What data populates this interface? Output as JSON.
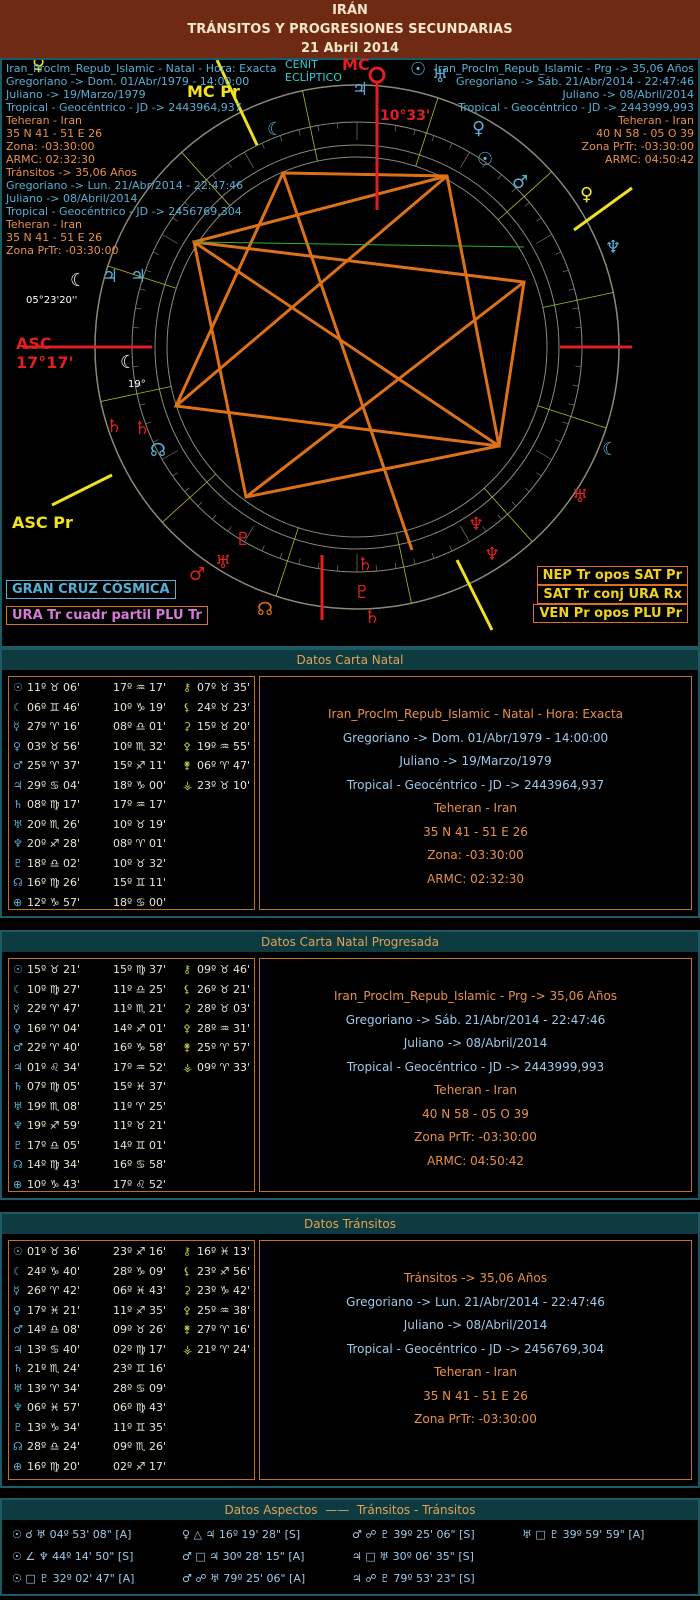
{
  "header": {
    "country": "IRÁN",
    "title": "TRÁNSITOS Y PROGRESIONES SECUNDARIAS",
    "date": "21 Abril 2014"
  },
  "chart_left": {
    "lines": [
      "Iran_Proclm_Repub_Islamic - Natal - Hora: Exacta",
      "Gregoriano -> Dom. 01/Abr/1979 - 14:00:00",
      "Juliano -> 19/Marzo/1979",
      "Tropical - Geocéntrico - JD -> 2443964,937",
      "Teheran - Iran",
      "35 N 41 - 51 E 26",
      "Zona: -03:30:00",
      "ARMC: 02:32:30",
      "Tránsitos -> 35,06 Años",
      "Gregoriano -> Lun. 21/Abr/2014 - 22:47:46",
      "Juliano -> 08/Abril/2014",
      "Tropical - Geocéntrico - JD -> 2456769,304",
      "Teheran - Iran",
      "35 N 41 - 51 E 26",
      "Zona PrTr: -03:30:00"
    ]
  },
  "chart_right": {
    "lines": [
      "Iran_Proclm_Repub_Islamic - Prg -> 35,06 Años",
      "Gregoriano -> Sáb. 21/Abr/2014 - 22:47:46",
      "Juliano -> 08/Abril/2014",
      "Tropical - Geocéntrico - JD -> 2443999,993",
      "Teheran - Iran",
      "40 N 58 - 05 O 39",
      "Zona PrTr: -03:30:00",
      "ARMC: 04:50:42"
    ]
  },
  "chart_labels": {
    "cenit": "CENIT",
    "ecliptico": "ECLÍPTICO",
    "mc": "MC",
    "mc_pr": "MC Pr",
    "mc_deg": "10°33'",
    "asc": "ASC",
    "asc_deg": "17°17'",
    "asc_pr": "ASC Pr",
    "moon_deg": "05°23'20''",
    "moon_small": "19°"
  },
  "badges": [
    {
      "text": "GRAN CRUZ CÓSMICA",
      "color": "#56b0d6"
    },
    {
      "text": "URA Tr cuadr partil PLU Tr",
      "color": "#d67ad6"
    },
    {
      "text": "NEP Tr opos SAT Pr",
      "color": "#f0d020"
    },
    {
      "text": "SAT Tr conj URA Rx",
      "color": "#f0d020"
    },
    {
      "text": "VEN Pr opos PLU Pr",
      "color": "#f0d020"
    }
  ],
  "natal": {
    "bar": "Datos Carta Natal",
    "col1": [
      {
        "g": "☉",
        "v": "11º ♉ 06'"
      },
      {
        "g": "☾",
        "v": "06º ♊ 46'"
      },
      {
        "g": "☿",
        "v": "27º ♈ 16'"
      },
      {
        "g": "♀",
        "v": "03º ♉ 56'"
      },
      {
        "g": "♂",
        "v": "25º ♈ 37'"
      },
      {
        "g": "♃",
        "v": "29º ♋ 04'"
      },
      {
        "g": "♄",
        "v": "08º ♍ 17'"
      },
      {
        "g": "♅",
        "v": "20º ♏ 26'"
      },
      {
        "g": "♆",
        "v": "20º ♐ 28'"
      },
      {
        "g": "♇",
        "v": "18º ♎ 02'"
      },
      {
        "g": "☊",
        "v": "16º ♍ 26'"
      },
      {
        "g": "⊕",
        "v": "12º ♑ 57'"
      }
    ],
    "col2": [
      "17º ♒ 17'",
      "10º ♑ 19'",
      "08º ♎ 01'",
      "10º ♏ 32'",
      "15º ♐ 11'",
      "18º ♑ 00'",
      "17º ♒ 17'",
      "10º ♉ 19'",
      "08º ♈ 01'",
      "10º ♉ 32'",
      "15º ♊ 11'",
      "18º ♋ 00'"
    ],
    "col3": [
      {
        "g": "⚷",
        "v": "07º ♉ 35'"
      },
      {
        "g": "⚸",
        "v": "24º ♉ 23'"
      },
      {
        "g": "⚳",
        "v": "15º ♉ 20'"
      },
      {
        "g": "⚴",
        "v": "19º ♒ 55'"
      },
      {
        "g": "⚵",
        "v": "06º ♈ 47'"
      },
      {
        "g": "⚶",
        "v": "23º ♉ 10'"
      }
    ],
    "info": [
      "Iran_Proclm_Repub_Islamic - Natal - Hora: Exacta",
      "Gregoriano -> Dom. 01/Abr/1979 - 14:00:00",
      "Juliano -> 19/Marzo/1979",
      "Tropical - Geocéntrico - JD -> 2443964,937",
      "Teheran - Iran",
      "35 N 41 - 51 E 26",
      "Zona: -03:30:00",
      "ARMC: 02:32:30"
    ]
  },
  "progresada": {
    "bar": "Datos Carta Natal Progresada",
    "col1": [
      {
        "g": "☉",
        "v": "15º ♉ 21'"
      },
      {
        "g": "☾",
        "v": "10º ♍ 27'"
      },
      {
        "g": "☿",
        "v": "22º ♈ 47'"
      },
      {
        "g": "♀",
        "v": "16º ♈ 04'"
      },
      {
        "g": "♂",
        "v": "22º ♈ 40'"
      },
      {
        "g": "♃",
        "v": "01º ♌ 34'"
      },
      {
        "g": "♄",
        "v": "07º ♍ 05'"
      },
      {
        "g": "♅",
        "v": "19º ♏ 08'"
      },
      {
        "g": "♆",
        "v": "19º ♐ 59'"
      },
      {
        "g": "♇",
        "v": "17º ♎ 05'"
      },
      {
        "g": "☊",
        "v": "14º ♍ 34'"
      },
      {
        "g": "⊕",
        "v": "10º ♑ 43'"
      }
    ],
    "col2": [
      "15º ♍ 37'",
      "11º ♎ 25'",
      "11º ♏ 21'",
      "14º ♐ 01'",
      "16º ♑ 58'",
      "17º ♒ 52'",
      "15º ♓ 37'",
      "11º ♈ 25'",
      "11º ♉ 21'",
      "14º ♊ 01'",
      "16º ♋ 58'",
      "17º ♌ 52'"
    ],
    "col3": [
      {
        "g": "⚷",
        "v": "09º ♉ 46'"
      },
      {
        "g": "⚸",
        "v": "26º ♉ 21'"
      },
      {
        "g": "⚳",
        "v": "28º ♉ 03'"
      },
      {
        "g": "⚴",
        "v": "28º ♒ 31'"
      },
      {
        "g": "⚵",
        "v": "25º ♈ 57'"
      },
      {
        "g": "⚶",
        "v": "09º ♈ 33'"
      }
    ],
    "info": [
      "Iran_Proclm_Repub_Islamic - Prg -> 35,06 Años",
      "Gregoriano -> Sáb. 21/Abr/2014 - 22:47:46",
      "Juliano -> 08/Abril/2014",
      "Tropical - Geocéntrico - JD -> 2443999,993",
      "Teheran - Iran",
      "40 N 58 - 05 O 39",
      "Zona PrTr: -03:30:00",
      "ARMC: 04:50:42"
    ]
  },
  "transitos": {
    "bar": "Datos Tránsitos",
    "col1": [
      {
        "g": "☉",
        "v": "01º ♉ 36'"
      },
      {
        "g": "☾",
        "v": "24º ♑ 40'"
      },
      {
        "g": "☿",
        "v": "26º ♈ 42'"
      },
      {
        "g": "♀",
        "v": "17º ♓ 21'"
      },
      {
        "g": "♂",
        "v": "14º ♎ 08'"
      },
      {
        "g": "♃",
        "v": "13º ♋ 40'"
      },
      {
        "g": "♄",
        "v": "21º ♏ 24'"
      },
      {
        "g": "♅",
        "v": "13º ♈ 34'"
      },
      {
        "g": "♆",
        "v": "06º ♓ 57'"
      },
      {
        "g": "♇",
        "v": "13º ♑ 34'"
      },
      {
        "g": "☊",
        "v": "28º ♎ 24'"
      },
      {
        "g": "⊕",
        "v": "16º ♍ 20'"
      }
    ],
    "col2": [
      "23º ♐ 16'",
      "28º ♑ 09'",
      "06º ♓ 43'",
      "11º ♐ 35'",
      "09º ♉ 26'",
      "02º ♍ 17'",
      "23º ♊ 16'",
      "28º ♋ 09'",
      "06º ♍ 43'",
      "11º ♊ 35'",
      "09º ♏ 26'",
      "02º ♐ 17'"
    ],
    "col3": [
      {
        "g": "⚷",
        "v": "16º ♓ 13'"
      },
      {
        "g": "⚸",
        "v": "23º ♐ 56'"
      },
      {
        "g": "⚳",
        "v": "23º ♑ 42'"
      },
      {
        "g": "⚴",
        "v": "25º ♒ 38'"
      },
      {
        "g": "⚵",
        "v": "27º ♈ 16'"
      },
      {
        "g": "⚶",
        "v": "21º ♈ 24'"
      }
    ],
    "info": [
      "Tránsitos -> 35,06 Años",
      "Gregoriano -> Lun. 21/Abr/2014 - 22:47:46",
      "Juliano -> 08/Abril/2014",
      "Tropical - Geocéntrico - JD -> 2456769,304",
      "Teheran - Iran",
      "35 N 41 - 51 E 26",
      "Zona PrTr: -03:30:00"
    ]
  },
  "aspectos": {
    "bar": "Datos Aspectos",
    "bar_right": "Tránsitos - Tránsitos",
    "rows": [
      [
        "☉ ☌ ♅ 04º 53' 08\" [A]",
        "♀ △ ♃ 16º 19' 28\" [S]",
        "♂ ☍ ♇ 39º 25' 06\" [S]",
        "♅ □ ♇ 39º 59' 59\" [A]"
      ],
      [
        "☉ ∠ ♆ 44º 14' 50\" [S]",
        "♂ □ ♃ 30º 28' 15\" [A]",
        "♃ □ ♅ 30º 06' 35\" [S]",
        ""
      ],
      [
        "☉ □ ♇ 32º 02' 47\" [A]",
        "♂ ☍ ♅ 79º 25' 06\" [A]",
        "♃ ☍ ♇ 79º 53' 23\" [S]",
        ""
      ]
    ]
  }
}
